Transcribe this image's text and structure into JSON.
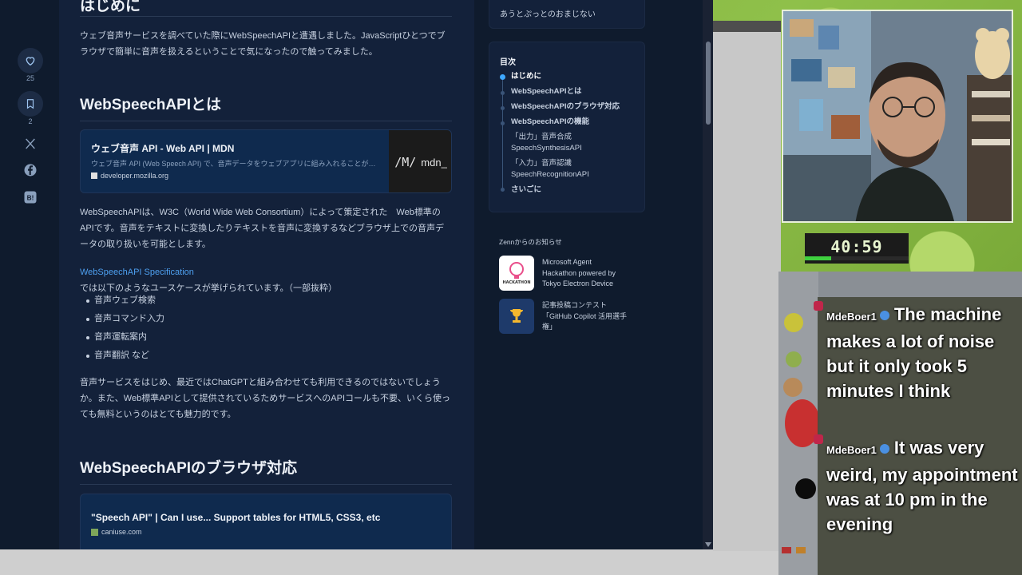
{
  "browser": {
    "sidebar": {
      "like_count": "25",
      "bookmark_count": "2"
    },
    "article": {
      "intro_heading": "はじめに",
      "intro_text": "ウェブ音声サービスを調べていた際にWebSpeechAPIと遭遇しました。JavaScriptひとつでブラウザで簡単に音声を扱えるということで気になったので触ってみました。",
      "section1_heading": "WebSpeechAPIとは",
      "mdn_card": {
        "title": "ウェブ音声 API - Web API | MDN",
        "description": "ウェブ音声 API (Web Speech API) で、音声データをウェブアプリに組み入れることが…",
        "domain": "developer.mozilla.org",
        "logo_text": "mdn_"
      },
      "section1_text": "WebSpeechAPIは、W3C（World Wide Web Consortium）によって策定された　Web標準のAPIです。音声をテキストに変換したりテキストを音声に変換するなどブラウザ上での音声データの取り扱いを可能とします。",
      "spec_link": "WebSpeechAPI Specification",
      "spec_text": " では以下のようなユースケースが挙げられています。（一部抜粋）",
      "use_cases": [
        "音声ウェブ検索",
        "音声コマンド入力",
        "音声運転案内",
        "音声翻訳 など"
      ],
      "paragraph3": "音声サービスをはじめ、最近ではChatGPTと組み合わせても利用できるのではないでしょうか。また、Web標準APIとして提供されているためサービスへのAPIコールも不要、いくら使っても無料というのはとても魅力的です。",
      "section2_heading": "WebSpeechAPIのブラウザ対応",
      "caniuse_card": {
        "title": "\"Speech API\" | Can I use... Support tables for HTML5, CSS3, etc",
        "domain": "caniuse.com"
      }
    },
    "right_column": {
      "top_text": "あうとぷっとのおまじない",
      "toc_title": "目次",
      "toc_items": [
        {
          "label": "はじめに"
        },
        {
          "label": "WebSpeechAPIとは"
        },
        {
          "label": "WebSpeechAPIのブラウザ対応"
        },
        {
          "label": "WebSpeechAPIの機能"
        },
        {
          "label": "「出力」音声合成"
        },
        {
          "label": "SpeechSynthesisAPI"
        },
        {
          "label": "「入力」音声認識"
        },
        {
          "label": "SpeechRecognitionAPI"
        },
        {
          "label": "さいごに"
        }
      ],
      "news_title": "Zennからのお知らせ",
      "news": [
        {
          "icon_label": "HACKATHON",
          "text1": "Microsoft Agent",
          "text2": "Hackathon powered by",
          "text3": "Tokyo Electron Device"
        },
        {
          "text1": "記事投稿コンテスト",
          "text2": "「GitHub Copilot 活用選手",
          "text3": "権」"
        }
      ]
    }
  },
  "overlay": {
    "timer": "40:59",
    "timer_progress": 0.25,
    "chat": [
      {
        "user": "MdeBoer1",
        "message": "The machine makes a lot of noise but it only took 5 minutes I think"
      },
      {
        "user": "MdeBoer1",
        "message": "It was very weird, my appointment was at 10 pm in the evening"
      }
    ]
  }
}
